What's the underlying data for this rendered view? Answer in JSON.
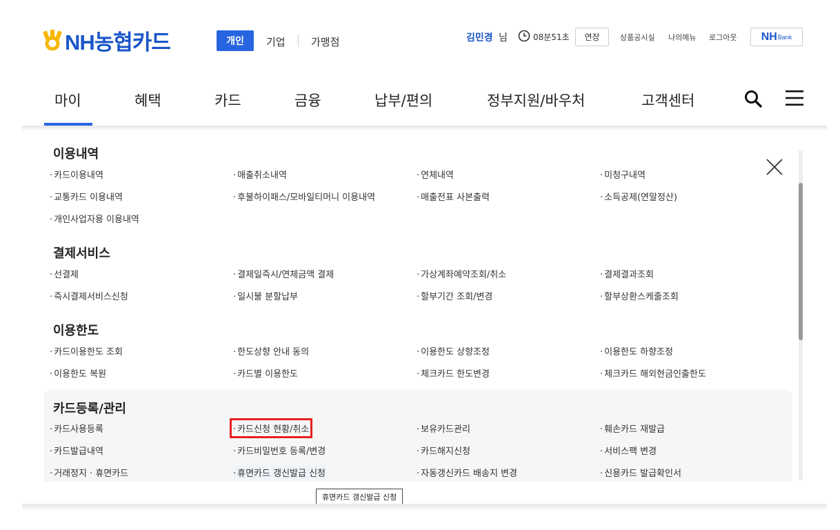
{
  "brand": {
    "name": "NH농협카드"
  },
  "tabs": {
    "personal": "개인",
    "business": "기업",
    "merchant": "가맹점"
  },
  "user": {
    "name": "김민경",
    "suffix": "님"
  },
  "session": {
    "timer": "08분51초",
    "extend_label": "연장"
  },
  "util_links": [
    "상품공시실",
    "나의메뉴",
    "로그아웃"
  ],
  "nhbank": {
    "nh": "NH",
    "bank": "Bank"
  },
  "gnb": [
    "마이",
    "혜택",
    "카드",
    "금융",
    "납부/편의",
    "정부지원/바우처",
    "고객센터"
  ],
  "sections": [
    {
      "title": "이용내역",
      "rows": [
        [
          "카드이용내역",
          "매출취소내역",
          "연체내역",
          "미청구내역"
        ],
        [
          "교통카드 이용내역",
          "후불하이패스/모바일티머니 이용내역",
          "매출전표 사본출력",
          "소득공제(연말정산)"
        ],
        [
          "개인사업자용 이용내역"
        ]
      ]
    },
    {
      "title": "결제서비스",
      "rows": [
        [
          "선결제",
          "결제일즉시/연체금액 결제",
          "가상계좌예약조회/취소",
          "결제결과조회"
        ],
        [
          "즉시결제서비스신청",
          "일시불 분할납부",
          "할부기간 조회/변경",
          "할부상환스케줄조회"
        ]
      ]
    },
    {
      "title": "이용한도",
      "rows": [
        [
          "카드이용한도 조회",
          "한도상향 안내 동의",
          "이용한도 상향조정",
          "이용한도 하향조정"
        ],
        [
          "이용한도 복원",
          "카드별 이용한도",
          "체크카드 한도변경",
          "체크카드 해외현금인출한도"
        ]
      ]
    },
    {
      "title": "카드등록/관리",
      "rows": [
        [
          "카드사용등록",
          "카드신청 현황/취소",
          "보유카드관리",
          "훼손카드 재발급"
        ],
        [
          "카드발급내역",
          "카드비밀번호 등록/변경",
          "카드해지신청",
          "서비스팩 변경"
        ],
        [
          "거래정지 · 휴면카드",
          "휴면카드 갱신발급 신청",
          "자동갱신카드 배송지 변경",
          "신용카드 발급확인서"
        ]
      ]
    }
  ],
  "tooltip": "휴면카드 갱신발급 신청"
}
